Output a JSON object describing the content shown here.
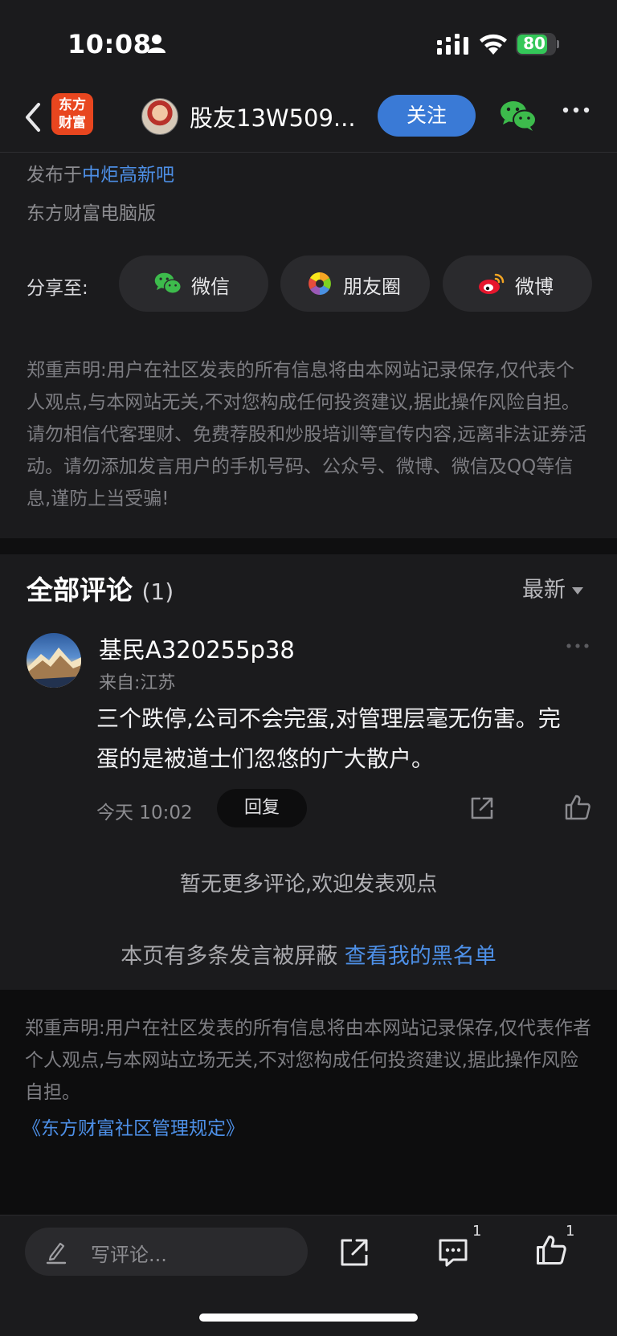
{
  "status_bar": {
    "time": "10:08",
    "battery_text": "80",
    "battery_level": 0.8
  },
  "nav": {
    "logo_line1": "东方",
    "logo_line2": "财富",
    "username": "股友13W509...",
    "follow_label": "关注"
  },
  "post": {
    "published_prefix": "发布于",
    "forum_name": "中炬高新吧",
    "source": "东方财富电脑版"
  },
  "share": {
    "label": "分享至:",
    "options": [
      {
        "label": "微信",
        "icon": "wechat-icon"
      },
      {
        "label": "朋友圈",
        "icon": "moments-icon"
      },
      {
        "label": "微博",
        "icon": "weibo-icon"
      }
    ]
  },
  "disclaimer_top": "郑重声明:用户在社区发表的所有信息将由本网站记录保存,仅代表个人观点,与本网站无关,不对您构成任何投资建议,据此操作风险自担。请勿相信代客理财、免费荐股和炒股培训等宣传内容,远离非法证券活动。请勿添加发言用户的手机号码、公众号、微博、微信及QQ等信息,谨防上当受骗!",
  "comments": {
    "title": "全部评论",
    "count": "(1)",
    "sort_label": "最新",
    "items": [
      {
        "user": "基民A320255p38",
        "location": "来自:江苏",
        "body": "三个跌停,公司不会完蛋,对管理层毫无伤害。完蛋的是被道士们忽悠的广大散户。",
        "time": "今天 10:02",
        "reply_label": "回复"
      }
    ],
    "no_more_text": "暂无更多评论,欢迎发表观点",
    "blocked_text": "本页有多条发言被屏蔽",
    "blacklist_link": "查看我的黑名单"
  },
  "disclaimer_bottom": "郑重声明:用户在社区发表的所有信息将由本网站记录保存,仅代表作者个人观点,与本网站立场无关,不对您构成任何投资建议,据此操作风险自担。",
  "rules_link": "《东方财富社区管理规定》",
  "bottom_bar": {
    "input_placeholder": "写评论...",
    "comment_count": "1",
    "like_count": "1"
  },
  "colors": {
    "background": "#1b1b1d",
    "accent_blue": "#3a7ad6",
    "link_blue": "#4d8fe6",
    "logo_orange": "#e8461f",
    "battery_green": "#34c759"
  }
}
